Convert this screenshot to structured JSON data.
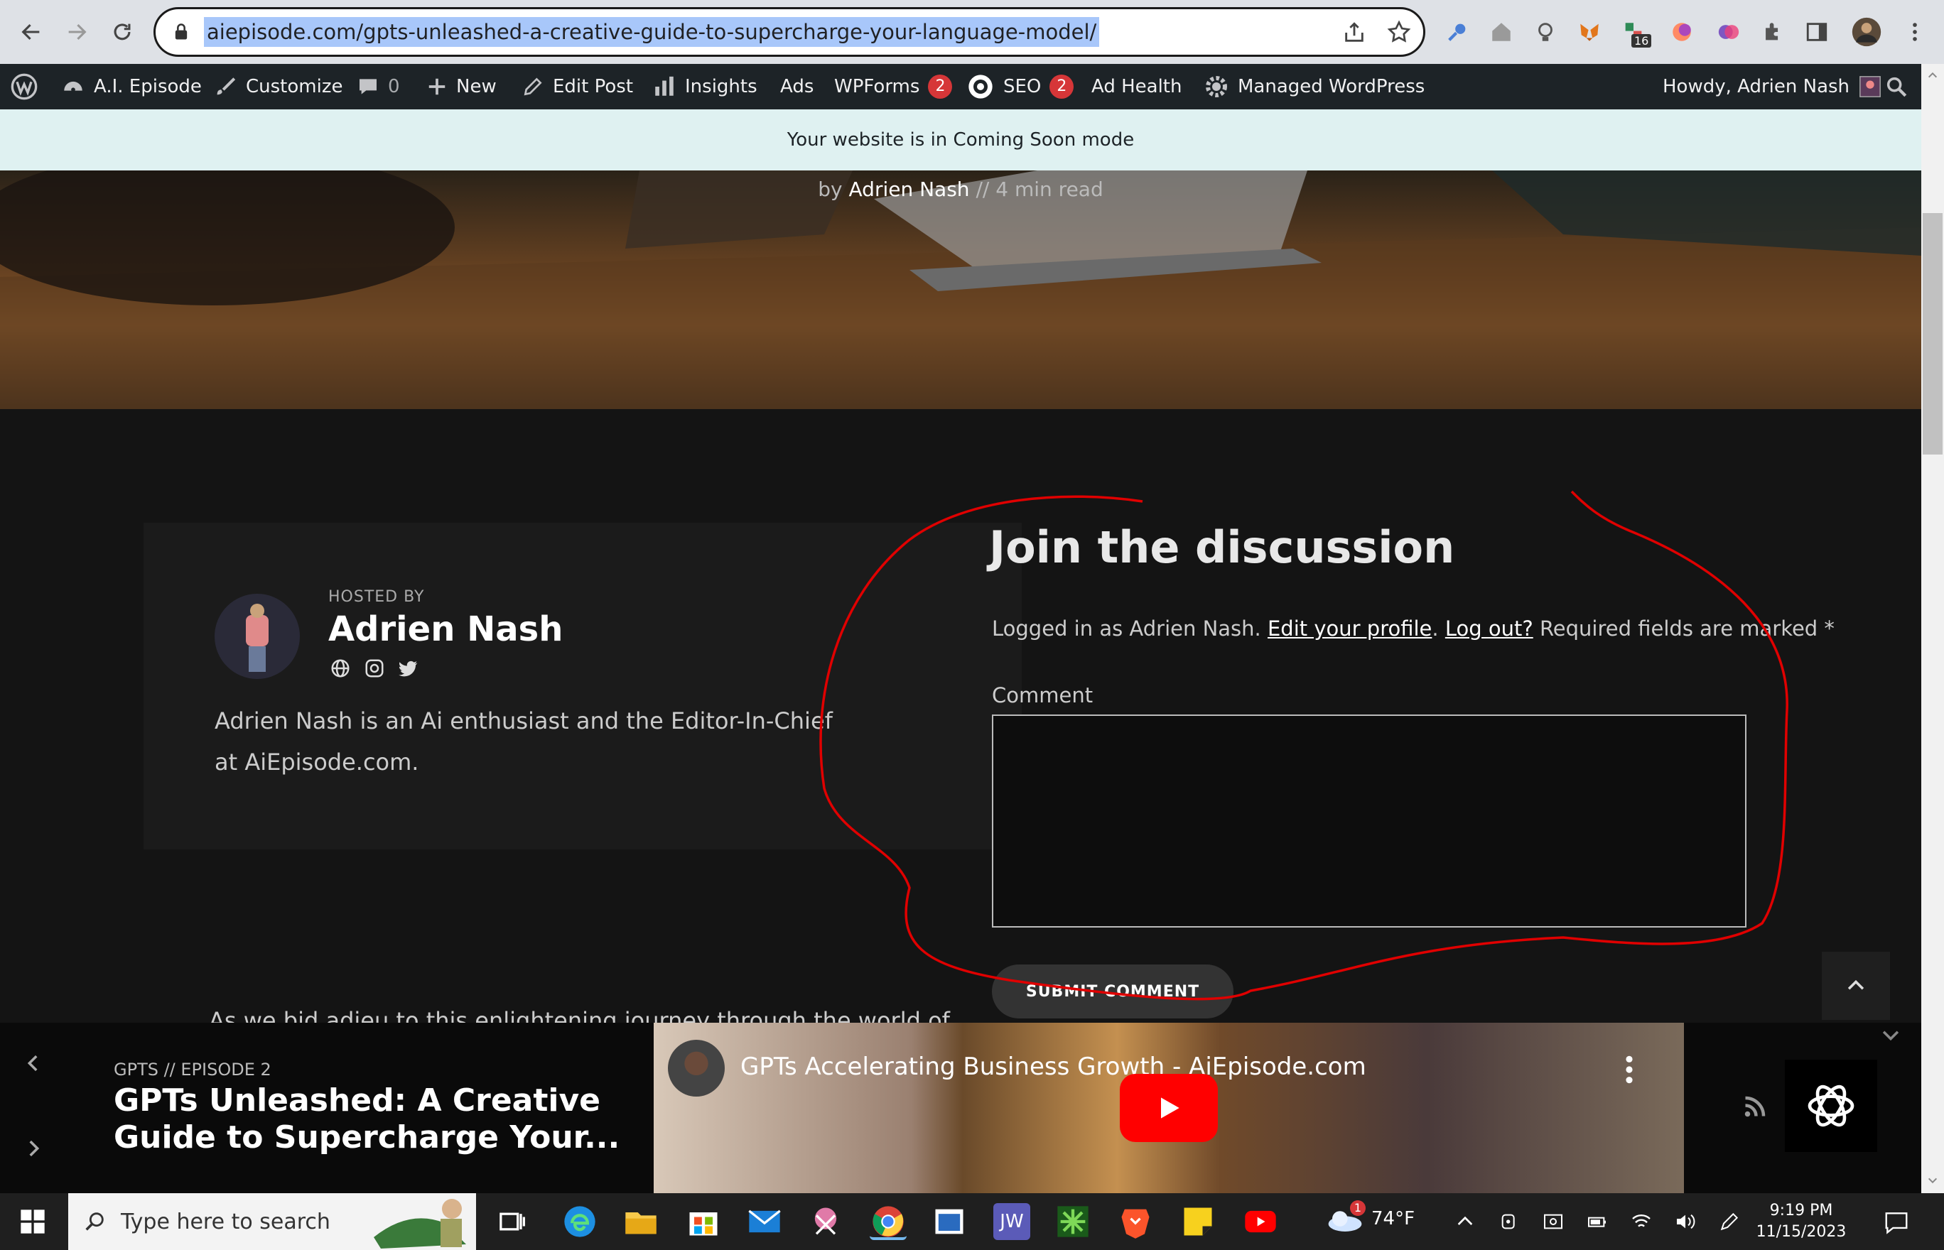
{
  "browser": {
    "url": "aiepisode.com/gpts-unleashed-a-creative-guide-to-supercharge-your-language-model/",
    "extension_badge": "16"
  },
  "admin_bar": {
    "site_name": "A.I. Episode",
    "customize": "Customize",
    "comments_count": "0",
    "new": "New",
    "edit_post": "Edit Post",
    "insights": "Insights",
    "ads": "Ads",
    "wpforms": "WPForms",
    "wpforms_badge": "2",
    "seo": "SEO",
    "seo_badge": "2",
    "ad_health": "Ad Health",
    "managed_wordpress": "Managed WordPress",
    "howdy": "Howdy, Adrien Nash"
  },
  "notice": "Your website is in Coming Soon mode",
  "hero": {
    "by": "by",
    "author": "Adrien Nash",
    "separator": "//",
    "read_time": "4 min read"
  },
  "host": {
    "label": "HOSTED BY",
    "name": "Adrien Nash",
    "bio": "Adrien Nash is an Ai enthusiast and the Editor-In-Chief at AiEpisode.com."
  },
  "discussion": {
    "title": "Join the discussion",
    "logged_in_prefix": "Logged in as Adrien Nash.",
    "edit_profile": "Edit your profile",
    "log_out": "Log out?",
    "required": "Required fields are marked *",
    "comment_label": "Comment",
    "comment_value": "",
    "submit": "SUBMIT COMMENT"
  },
  "teaser": "As we bid adieu to this enlightening journey through the world of",
  "player": {
    "meta": "GPTS // EPISODE 2",
    "title": "GPTs Unleashed: A Creative Guide to Supercharge Your...",
    "video_title": "GPTs Accelerating Business Growth - AiEpisode.com"
  },
  "taskbar": {
    "search_placeholder": "Type here to search",
    "weather": "74°F",
    "weather_badge": "1",
    "time": "9:19 PM",
    "date": "11/15/2023",
    "jw_label": "JW"
  },
  "colors": {
    "annotation_red": "#e00000",
    "badge_red": "#d63638",
    "notice_bg": "#dff1f1",
    "url_highlight": "#a8c7fa"
  }
}
